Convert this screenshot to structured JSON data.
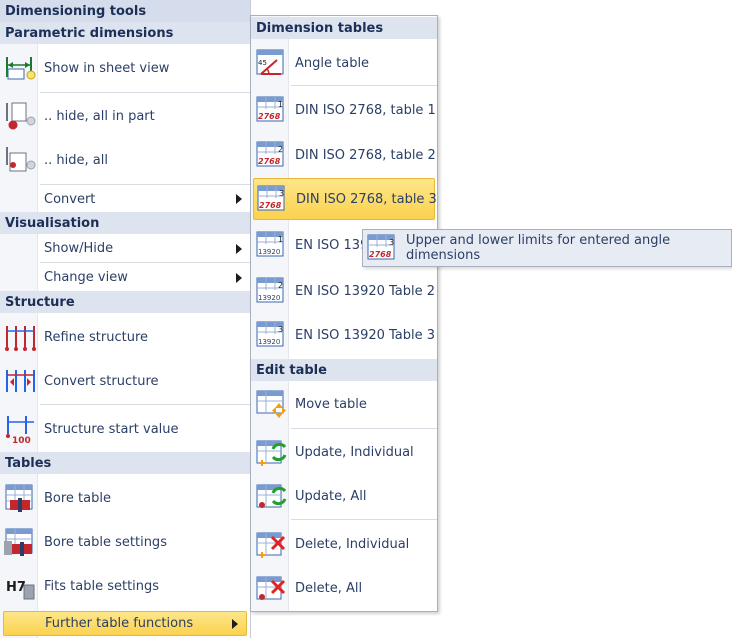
{
  "main_menu": {
    "title": "Dimensioning tools",
    "sections": {
      "parametric": "Parametric dimensions",
      "visualisation": "Visualisation",
      "structure": "Structure",
      "tables": "Tables"
    },
    "items": {
      "show_in_sheet_view": "Show in sheet view",
      "hide_all_in_part": ".. hide, all in part",
      "hide_all": ".. hide, all",
      "convert": "Convert",
      "show_hide": "Show/Hide",
      "change_view": "Change view",
      "refine_structure": "Refine structure",
      "convert_structure": "Convert structure",
      "structure_start_value": "Structure start value",
      "bore_table": "Bore table",
      "bore_table_settings": "Bore table settings",
      "fits_table_settings": "Fits table settings",
      "further_table_functions": "Further table functions"
    }
  },
  "sub_menu": {
    "sections": {
      "dimension_tables": "Dimension tables",
      "edit_table": "Edit table"
    },
    "items": {
      "angle_table": "Angle table",
      "din_1": "DIN ISO 2768, table 1",
      "din_2": "DIN ISO 2768, table 2",
      "din_3": "DIN ISO 2768, table 3",
      "en_1": "EN ISO 13920 Table 1",
      "en_2": "EN ISO 13920 Table 2",
      "en_3": "EN ISO 13920 Table 3",
      "move_table": "Move table",
      "update_individual": "Update, Individual",
      "update_all": "Update, All",
      "delete_individual": "Delete, Individual",
      "delete_all": "Delete, All"
    }
  },
  "tooltip": {
    "text": "Upper and lower limits for entered angle dimensions"
  },
  "icon_text": {
    "din_code": "2768",
    "en_code": "13920",
    "n1": "1",
    "n2": "2",
    "n3": "3",
    "fits": "H7",
    "struct_value": "100",
    "angle": "45"
  },
  "colors": {
    "section_header_bg": "#dde4ef",
    "text": "#2b3f66",
    "highlight": "#fbd24f",
    "tooltip_bg": "#e7ebf3"
  }
}
